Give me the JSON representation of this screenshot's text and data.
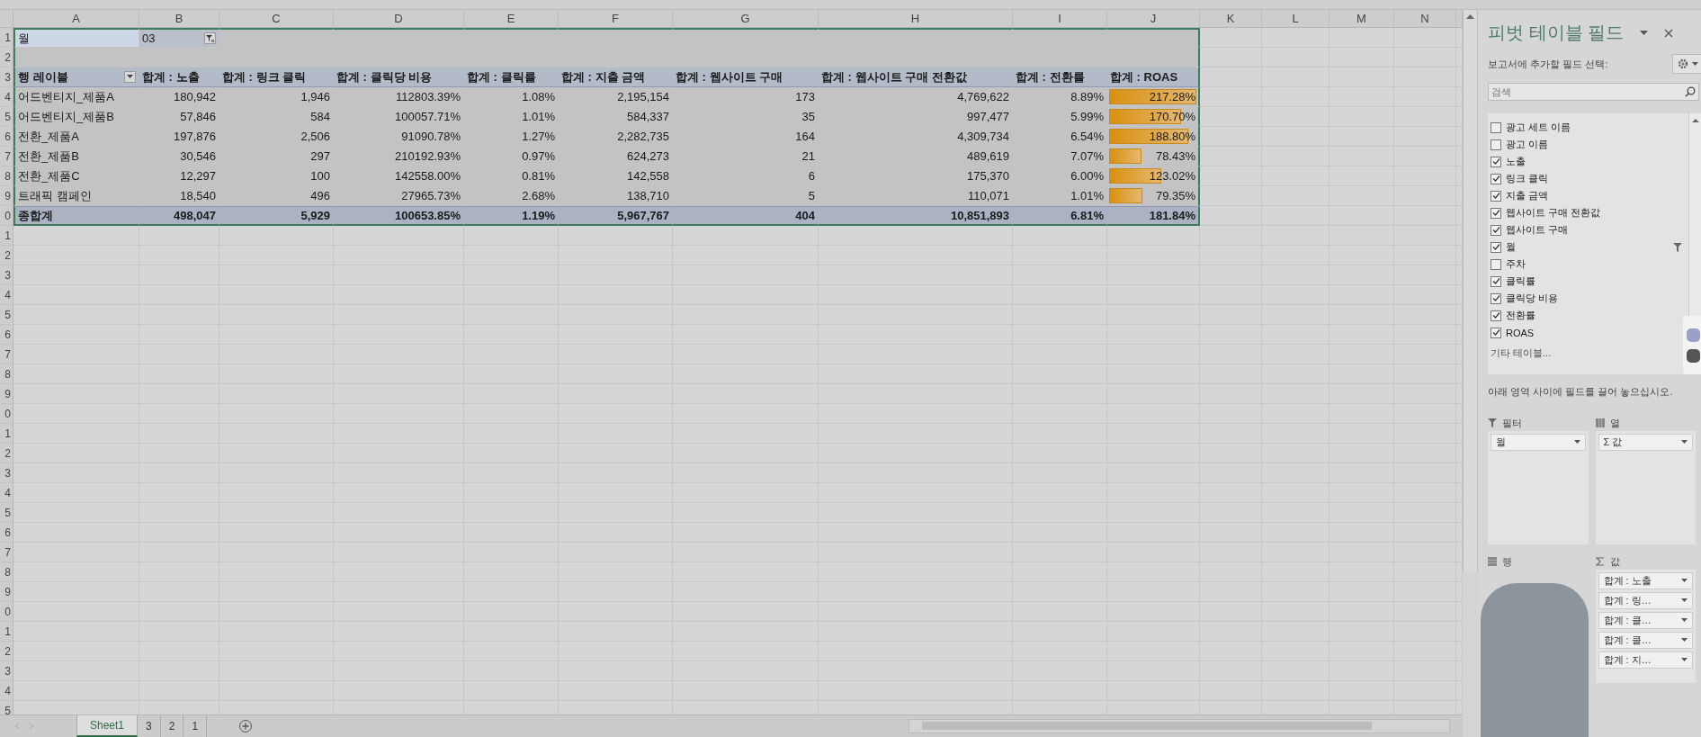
{
  "sheet": {
    "column_headers": [
      "A",
      "B",
      "C",
      "D",
      "E",
      "F",
      "G",
      "H",
      "I",
      "J",
      "K",
      "L",
      "M",
      "N"
    ],
    "row_numbers": [
      "1",
      "2",
      "3",
      "4",
      "5",
      "6",
      "7",
      "8",
      "9",
      "0",
      "1",
      "2",
      "3",
      "4",
      "5",
      "6",
      "7",
      "8",
      "9",
      "0",
      "1",
      "2",
      "3",
      "4",
      "5",
      "6",
      "7",
      "8",
      "9",
      "0",
      "1",
      "2",
      "3",
      "4",
      "5"
    ]
  },
  "pivot": {
    "filter": {
      "label": "월",
      "value": "03"
    },
    "headers": [
      "행 레이블",
      "합계 : 노출",
      "합계 : 링크 클릭",
      "합계 : 클릭당 비용",
      "합계 : 클릭률",
      "합계 : 지출 금액",
      "합계 : 웹사이트 구매",
      "합계 : 웹사이트 구매 전환값",
      "합계 : 전환률",
      "합계 : ROAS"
    ],
    "rows": [
      {
        "label": "어드벤티지_제품A",
        "values": [
          "180,942",
          "1,946",
          "112803.39%",
          "1.08%",
          "2,195,154",
          "173",
          "4,769,622",
          "8.89%",
          "217.28%"
        ],
        "level": 1.0
      },
      {
        "label": "어드벤티지_제품B",
        "values": [
          "57,846",
          "584",
          "100057.71%",
          "1.01%",
          "584,337",
          "35",
          "997,477",
          "5.99%",
          "170.70%"
        ],
        "level": 0.79
      },
      {
        "label": "전환_제품A",
        "values": [
          "197,876",
          "2,506",
          "91090.78%",
          "1.27%",
          "2,282,735",
          "164",
          "4,309,734",
          "6.54%",
          "188.80%"
        ],
        "level": 0.87
      },
      {
        "label": "전환_제품B",
        "values": [
          "30,546",
          "297",
          "210192.93%",
          "0.97%",
          "624,273",
          "21",
          "489,619",
          "7.07%",
          "78.43%"
        ],
        "level": 0.36
      },
      {
        "label": "전환_제품C",
        "values": [
          "12,297",
          "100",
          "142558.00%",
          "0.81%",
          "142,558",
          "6",
          "175,370",
          "6.00%",
          "123.02%"
        ],
        "level": 0.57
      },
      {
        "label": "트래픽 캠페인",
        "values": [
          "18,540",
          "496",
          "27965.73%",
          "2.68%",
          "138,710",
          "5",
          "110,071",
          "1.01%",
          "79.35%"
        ],
        "level": 0.37
      }
    ],
    "total": {
      "label": "종합계",
      "values": [
        "498,047",
        "5,929",
        "100653.85%",
        "1.19%",
        "5,967,767",
        "404",
        "10,851,893",
        "6.81%",
        "181.84%"
      ]
    }
  },
  "sheet_tabs": [
    {
      "label": "Sheet1",
      "selected": true
    },
    {
      "label": "3",
      "selected": false
    },
    {
      "label": "2",
      "selected": false
    },
    {
      "label": "1",
      "selected": false
    }
  ],
  "panel": {
    "title": "피벗 테이블 필드",
    "subtitle": "보고서에 추가할 필드 선택:",
    "search_placeholder": "검색",
    "fields": [
      {
        "label": "광고 세트 이름",
        "checked": false,
        "filtered": false
      },
      {
        "label": "광고 이름",
        "checked": false,
        "filtered": false
      },
      {
        "label": "노출",
        "checked": true,
        "filtered": false
      },
      {
        "label": "링크 클릭",
        "checked": true,
        "filtered": false
      },
      {
        "label": "지출 금액",
        "checked": true,
        "filtered": false
      },
      {
        "label": "웹사이트 구매 전환값",
        "checked": true,
        "filtered": false
      },
      {
        "label": "웹사이트 구매",
        "checked": true,
        "filtered": false
      },
      {
        "label": "월",
        "checked": true,
        "filtered": true
      },
      {
        "label": "주차",
        "checked": false,
        "filtered": false
      },
      {
        "label": "클릭률",
        "checked": true,
        "filtered": false
      },
      {
        "label": "클릭당 비용",
        "checked": true,
        "filtered": false
      },
      {
        "label": "전환률",
        "checked": true,
        "filtered": false
      },
      {
        "label": "ROAS",
        "checked": true,
        "filtered": false
      }
    ],
    "more_tables": "기타 테이블...",
    "instruction": "아래 영역 사이에 필드를 끌어 놓으십시오.",
    "areas": [
      {
        "kind": "filter",
        "label": "필터",
        "items": [
          "월"
        ]
      },
      {
        "kind": "column",
        "label": "열",
        "items": [
          "Σ 값"
        ]
      },
      {
        "kind": "row",
        "label": "행"
      },
      {
        "kind": "value",
        "label": "값",
        "items": [
          "합계 : 노출",
          "합계 : 링…",
          "합계 : 클…",
          "합계 : 클…",
          "합계 : 지…"
        ]
      }
    ]
  }
}
